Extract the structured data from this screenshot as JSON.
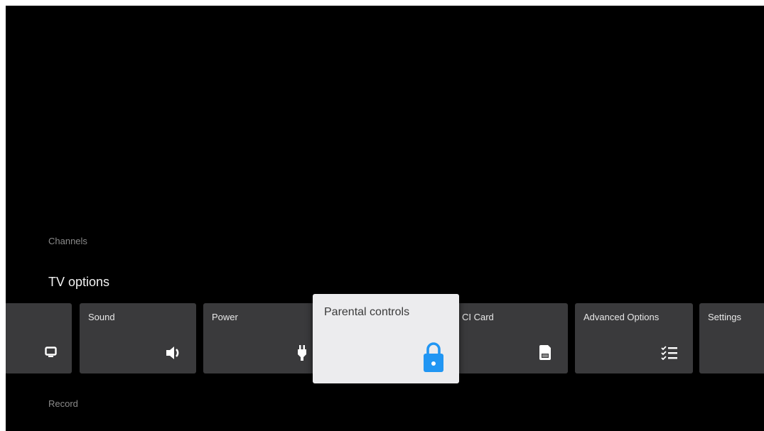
{
  "rows": {
    "channels_label": "Channels",
    "tv_options_title": "TV options",
    "record_label": "Record"
  },
  "tiles": [
    {
      "label": "",
      "icon": "display-icon"
    },
    {
      "label": "Sound",
      "icon": "speaker-icon"
    },
    {
      "label": "Power",
      "icon": "plug-icon"
    },
    {
      "label": "Parental controls",
      "icon": "lock-icon",
      "focused": true
    },
    {
      "label": "CI Card",
      "icon": "sim-card-icon"
    },
    {
      "label": "Advanced Options",
      "icon": "checklist-icon"
    },
    {
      "label": "Settings",
      "icon": ""
    }
  ],
  "colors": {
    "background": "#000000",
    "tile": "#3a3a3c",
    "focused_tile": "#ececee",
    "accent": "#2196f3"
  }
}
